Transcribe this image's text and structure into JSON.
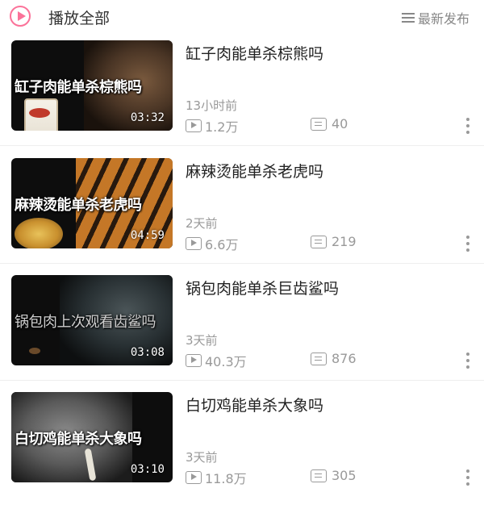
{
  "header": {
    "play_all_label": "播放全部",
    "sort_label": "最新发布"
  },
  "colors": {
    "accent": "#fb7299",
    "muted": "#999999"
  },
  "videos": [
    {
      "title": "缸子肉能单杀棕熊吗",
      "thumb_caption": "缸子肉能单杀棕熊吗",
      "duration": "03:32",
      "published": "13小时前",
      "views": "1.2万",
      "comments": "40"
    },
    {
      "title": "麻辣烫能单杀老虎吗",
      "thumb_caption": "麻辣烫能单杀老虎吗",
      "duration": "04:59",
      "published": "2天前",
      "views": "6.6万",
      "comments": "219"
    },
    {
      "title": "锅包肉能单杀巨齿鲨吗",
      "thumb_caption": "锅包肉上次观看齿鲨吗",
      "duration": "03:08",
      "published": "3天前",
      "views": "40.3万",
      "comments": "876"
    },
    {
      "title": "白切鸡能单杀大象吗",
      "thumb_caption": "白切鸡能单杀大象吗",
      "duration": "03:10",
      "published": "3天前",
      "views": "11.8万",
      "comments": "305"
    }
  ]
}
